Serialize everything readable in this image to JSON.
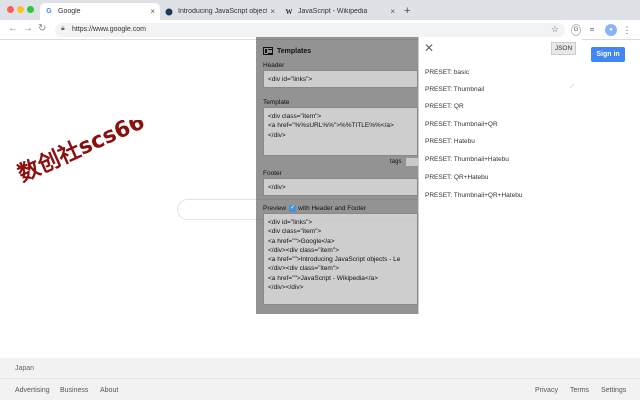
{
  "browser": {
    "tabs": [
      {
        "title": "Google",
        "icon": "google-favicon-icon"
      },
      {
        "title": "Introducing JavaScript objects",
        "icon": "mdn-favicon-icon"
      },
      {
        "title": "JavaScript - Wikipedia",
        "icon": "wikipedia-favicon-icon"
      }
    ],
    "new_tab_glyph": "+",
    "close_glyph": "×",
    "url": "https://www.google.com"
  },
  "page": {
    "signin_label": "Sign in",
    "country": "Japan",
    "footer_left": [
      "Advertising",
      "Business",
      "About"
    ],
    "footer_right": [
      "Privacy",
      "Terms",
      "Settings"
    ]
  },
  "watermark": {
    "text": "数创社scs66",
    "color": "#8b0f0f"
  },
  "templates": {
    "title": "Templates",
    "header_label": "Header",
    "header_value": "<div id=\"links\">",
    "template_label": "Template",
    "template_value": "<div class=\"item\">\n<a href=\"%%sURL%%\">%%TITLE%%</a>\n</div>",
    "tags_label": "tags",
    "footer_label": "Footer",
    "footer_value": "</div>",
    "preview_label": "Preview",
    "preview_option": "with Header and Footer",
    "preview_value": "<div id=\"links\">\n<div class=\"item\">\n<a href=\"\">Google</a>\n</div><div class=\"item\">\n<a href=\"\">Introducing JavaScript objects - Le\n</div><div class=\"item\">\n<a href=\"\">JavaScript - Wikipedia</a>\n</div></div>"
  },
  "presets": {
    "json_label": "JSON",
    "close_glyph": "✕",
    "items": [
      "PRESET: basic",
      "PRESET: Thumbnail",
      "PRESET: QR",
      "PRESET: Thumbnail+QR",
      "PRESET: Hatebu",
      "PRESET: Thumbnail+Hatebu",
      "PRESET: QR+Hatebu",
      "PRESET: Thumbnail+QR+Hatebu"
    ]
  },
  "colors": {
    "accent": "#4285f4",
    "overlay": "#505050"
  }
}
